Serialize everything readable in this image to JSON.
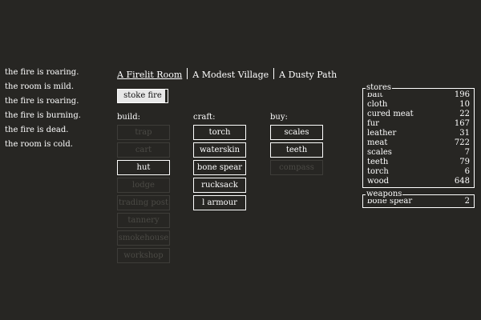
{
  "notifications": [
    "the fire is roaring.",
    "the room is mild.",
    "the fire is roaring.",
    "the fire is burning.",
    "the fire is dead.",
    "the room is cold."
  ],
  "header": {
    "locations": [
      {
        "label": "A Firelit Room",
        "selected": true
      },
      {
        "label": "A Modest Village",
        "selected": false
      },
      {
        "label": "A Dusty Path",
        "selected": false
      }
    ]
  },
  "stoke": {
    "label": "stoke fire"
  },
  "build": {
    "title": "build:",
    "items": [
      {
        "label": "trap",
        "enabled": false
      },
      {
        "label": "cart",
        "enabled": false
      },
      {
        "label": "hut",
        "enabled": true
      },
      {
        "label": "lodge",
        "enabled": false
      },
      {
        "label": "trading post",
        "enabled": false
      },
      {
        "label": "tannery",
        "enabled": false
      },
      {
        "label": "smokehouse",
        "enabled": false
      },
      {
        "label": "workshop",
        "enabled": false
      }
    ]
  },
  "craft": {
    "title": "craft:",
    "items": [
      {
        "label": "torch",
        "enabled": true
      },
      {
        "label": "waterskin",
        "enabled": true
      },
      {
        "label": "bone spear",
        "enabled": true
      },
      {
        "label": "rucksack",
        "enabled": true
      },
      {
        "label": "l armour",
        "enabled": true
      }
    ]
  },
  "buy": {
    "title": "buy:",
    "items": [
      {
        "label": "scales",
        "enabled": true
      },
      {
        "label": "teeth",
        "enabled": true
      },
      {
        "label": "compass",
        "enabled": false
      }
    ]
  },
  "stores": {
    "legend": "stores",
    "rows": [
      {
        "name": "bait",
        "value": "196"
      },
      {
        "name": "cloth",
        "value": "10"
      },
      {
        "name": "cured meat",
        "value": "22"
      },
      {
        "name": "fur",
        "value": "167"
      },
      {
        "name": "leather",
        "value": "31"
      },
      {
        "name": "meat",
        "value": "722"
      },
      {
        "name": "scales",
        "value": "7"
      },
      {
        "name": "teeth",
        "value": "79"
      },
      {
        "name": "torch",
        "value": "6"
      },
      {
        "name": "wood",
        "value": "648"
      }
    ]
  },
  "weapons": {
    "legend": "weapons",
    "rows": [
      {
        "name": "bone spear",
        "value": "2"
      }
    ]
  },
  "colors": {
    "background": "#272623",
    "text": "#ffffff",
    "disabled": "#4b4a45",
    "stoke_fill": "#e8e8e8"
  }
}
